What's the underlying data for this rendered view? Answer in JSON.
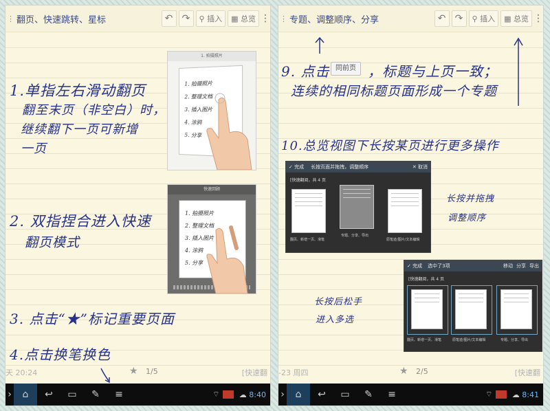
{
  "left": {
    "title": "翻页、快速跳转、星标",
    "insert_label": "插入",
    "overview_label": "总览",
    "step1_l1": "1.单指左右滑动翻页",
    "step1_l2": "翻至末页（非空白）时，",
    "step1_l3": "继续翻下一页可新增",
    "step1_l4": "一页",
    "step2_l1": "2. 双指捏合进入快速",
    "step2_l2": "翻页模式",
    "step3": "3. 点击“★”标记重要页面",
    "step4": "4.点击换笔换色",
    "footer_date": "天 20:24",
    "footer_page": "1/5",
    "footer_tag": "[快速翻",
    "time": "8:40"
  },
  "right": {
    "title": "专题、调整顺序、分享",
    "insert_label": "插入",
    "overview_label": "总览",
    "step9_l1_a": "9. 点击",
    "same_page_button": "同前页",
    "step9_l1_b": "，标题与上页一致；",
    "step9_l2": "连续的相同标题页面形成一个专题",
    "step10": "10.总览视图下长按某页进行更多操作",
    "shot1_done": "完成",
    "shot1_hint": "长按页面并拖拽，调整顺序",
    "shot1_cancel": "取消",
    "shot1_header": "[快速翻阅，共 4 页",
    "shot1_labels": [
      "翻页、新增一页、滑笔",
      "专题、分享、导出",
      "原笔迹/图片/文本编辑"
    ],
    "caption1_l1": "长按并拖拽",
    "caption1_l2": "调整顺序",
    "shot2_done": "完成",
    "shot2_selected": "选中了3项",
    "shot2_move": "移动",
    "shot2_share": "分享",
    "shot2_export": "导出",
    "shot2_header": "[快速翻阅，共 4 页",
    "shot2_labels": [
      "翻页、新增一页、滑笔",
      "原笔迹/图片/文本编辑",
      "专题、分享、导出"
    ],
    "caption2_l1": "长按后松手",
    "caption2_l2": "进入多选",
    "footer_date": "-23 周四",
    "footer_page": "2/5",
    "footer_tag": "[快速翻",
    "time": "8:41"
  },
  "mini_notes": [
    "1. 拍摄照片",
    "2. 整理文档",
    "3. 插入图片",
    "4. 涂鸦",
    "5. 分享"
  ],
  "mini_header": "快速回顾"
}
